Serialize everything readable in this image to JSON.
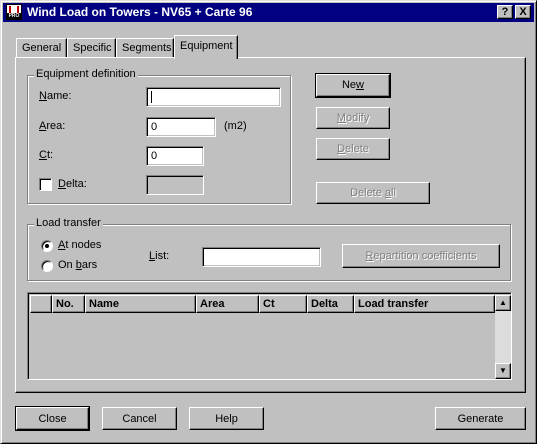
{
  "window": {
    "title": "Wind Load on Towers - NV65 + Carte 96",
    "help_button": "?",
    "close_button": "X"
  },
  "tabs": [
    {
      "label": "General",
      "active": false
    },
    {
      "label": "Specific",
      "active": false
    },
    {
      "label": "Segments",
      "active": false
    },
    {
      "label": "Equipment",
      "active": true
    }
  ],
  "equipment_definition": {
    "legend": "Equipment definition",
    "name_label": "Name:",
    "name_value": "",
    "area_label": "Area:",
    "area_value": "0",
    "area_unit": "(m2)",
    "ct_label": "Ct:",
    "ct_value": "0",
    "delta_label": "Delta:",
    "delta_checked": false,
    "delta_value": ""
  },
  "action_buttons": {
    "new": "New",
    "modify": "Modify",
    "delete": "Delete",
    "delete_all": "Delete all"
  },
  "load_transfer": {
    "legend": "Load transfer",
    "at_nodes": "At nodes",
    "on_bars": "On bars",
    "selected": "at_nodes",
    "list_label": "List:",
    "list_value": "",
    "repartition_button": "Repartition coefficients"
  },
  "table": {
    "columns": [
      "",
      "No.",
      "Name",
      "Area",
      "Ct",
      "Delta",
      "Load transfer"
    ],
    "rows": []
  },
  "footer": {
    "close": "Close",
    "cancel": "Cancel",
    "help": "Help",
    "generate": "Generate"
  },
  "colors": {
    "titlebar": "#000080",
    "face": "#c0c0c0",
    "disabled_text": "#808080"
  }
}
